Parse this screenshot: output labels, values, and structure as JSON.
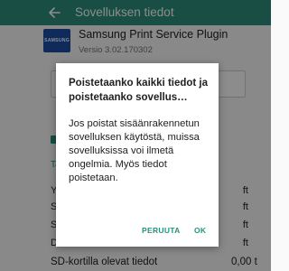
{
  "app_bar": {
    "back_icon": "arrow-left-icon",
    "title": "Sovelluksen tiedot",
    "color": "#2c8f7d"
  },
  "app_info": {
    "logo_text": "SAMSUNG",
    "name": "Samsung Print Service Plugin",
    "version": "Versio 3.02.170302"
  },
  "background": {
    "tab_label_visible": "Ta",
    "rows": [
      {
        "label": "Y",
        "value": "ft"
      },
      {
        "label": "S",
        "value": "ft"
      },
      {
        "label": "S",
        "value": "ft"
      },
      {
        "label": "D",
        "value": "ft"
      }
    ],
    "sd_row": {
      "label": "SD-kortilla olevat tiedot",
      "value": "0,00 t"
    }
  },
  "dialog": {
    "title": "Poistetaanko kaikki tiedot ja poistetaanko sovellus…",
    "message": "Jos poistat sisäänrakennetun sovelluksen käytöstä, muissa sovelluksissa voi ilmetä ongelmia. Myös tiedot poistetaan.",
    "cancel_label": "PERUUTA",
    "ok_label": "OK"
  }
}
